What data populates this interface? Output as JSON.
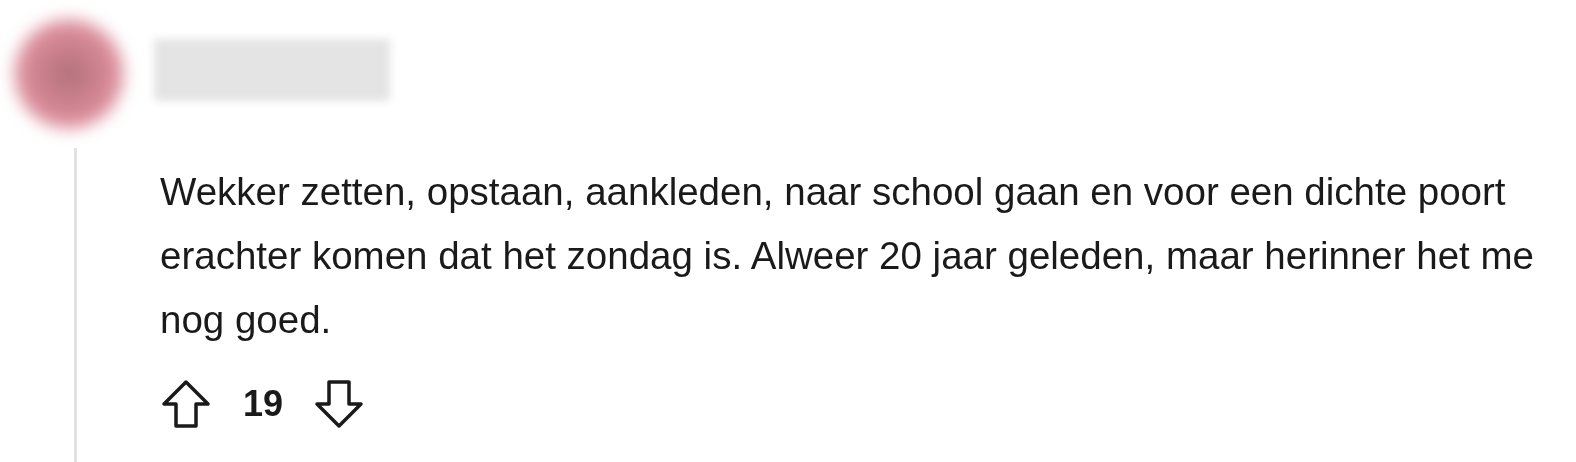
{
  "comment": {
    "body": "Wekker zetten, opstaan, aankleden, naar school gaan en voor een dichte poort erachter komen dat het zondag is. Alweer 20 jaar geleden, maar herinner het me nog goed.",
    "score": "19"
  }
}
